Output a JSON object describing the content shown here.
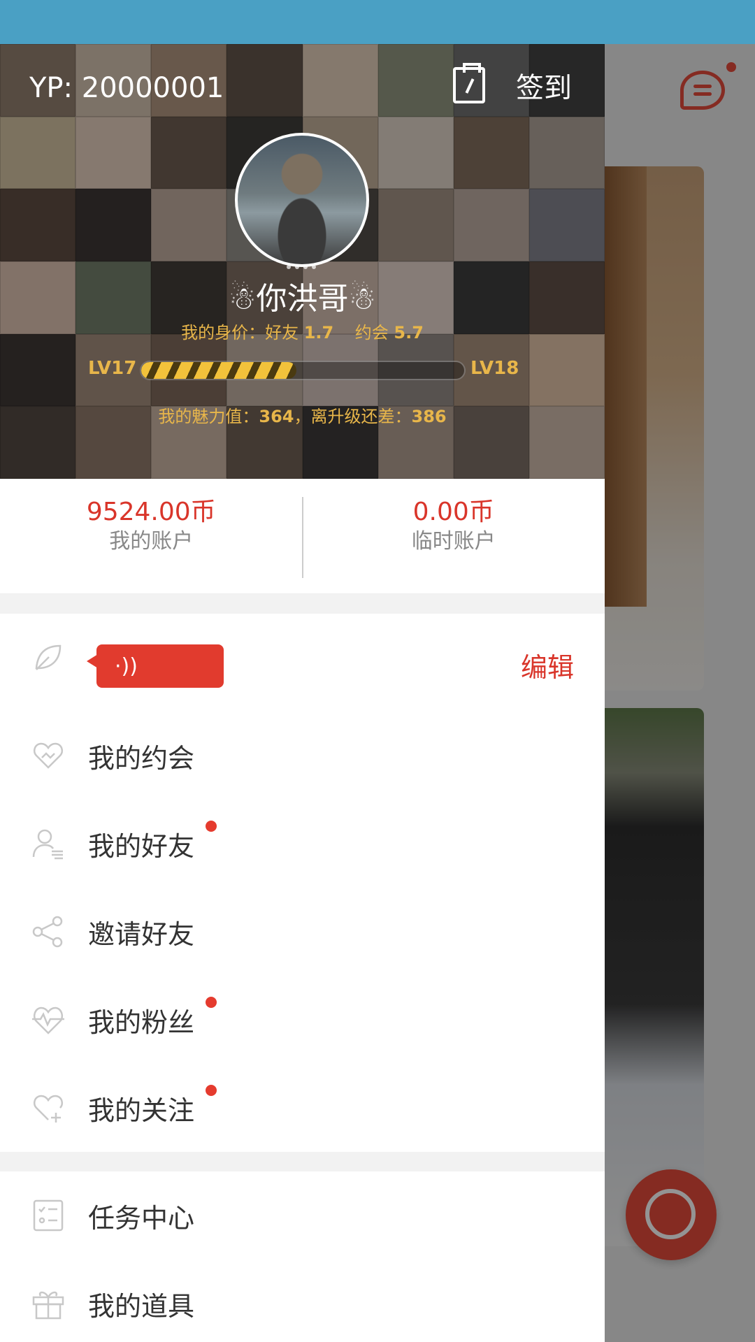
{
  "drawer": {
    "header": {
      "user_id": "YP: 20000001",
      "checkin_label": "签到",
      "nickname": "☃你洪哥☃",
      "worth_prefix": "我的身价：好友",
      "worth_friend": "1.7",
      "worth_date_label": "约会",
      "worth_date": "5.7",
      "level_current": "LV17",
      "level_next": "LV18",
      "level_progress": 0.48,
      "charm_prefix": "我的魅力值：",
      "charm_value": "364",
      "charm_mid": "，离升级还差：",
      "charm_remaining": "386"
    },
    "accounts": [
      {
        "amount": "9524.00币",
        "label": "我的账户"
      },
      {
        "amount": "0.00币",
        "label": "临时账户"
      }
    ],
    "voice": {
      "bubble_glyph": "·))",
      "edit_label": "编辑"
    },
    "menu": [
      {
        "label": "我的约会",
        "icon": "heart-handshake-icon",
        "badge": false
      },
      {
        "label": "我的好友",
        "icon": "friends-icon",
        "badge": true
      },
      {
        "label": "邀请好友",
        "icon": "share-icon",
        "badge": false
      },
      {
        "label": "我的粉丝",
        "icon": "heart-pulse-icon",
        "badge": true
      },
      {
        "label": "我的关注",
        "icon": "heart-plus-icon",
        "badge": true
      }
    ],
    "menu2": [
      {
        "label": "任务中心",
        "icon": "task-list-icon"
      },
      {
        "label": "我的道具",
        "icon": "gift-icon"
      }
    ]
  },
  "colors": {
    "status_bar": "#4aa0c4",
    "accent_red": "#d9352a",
    "gold": "#e8b64a"
  }
}
